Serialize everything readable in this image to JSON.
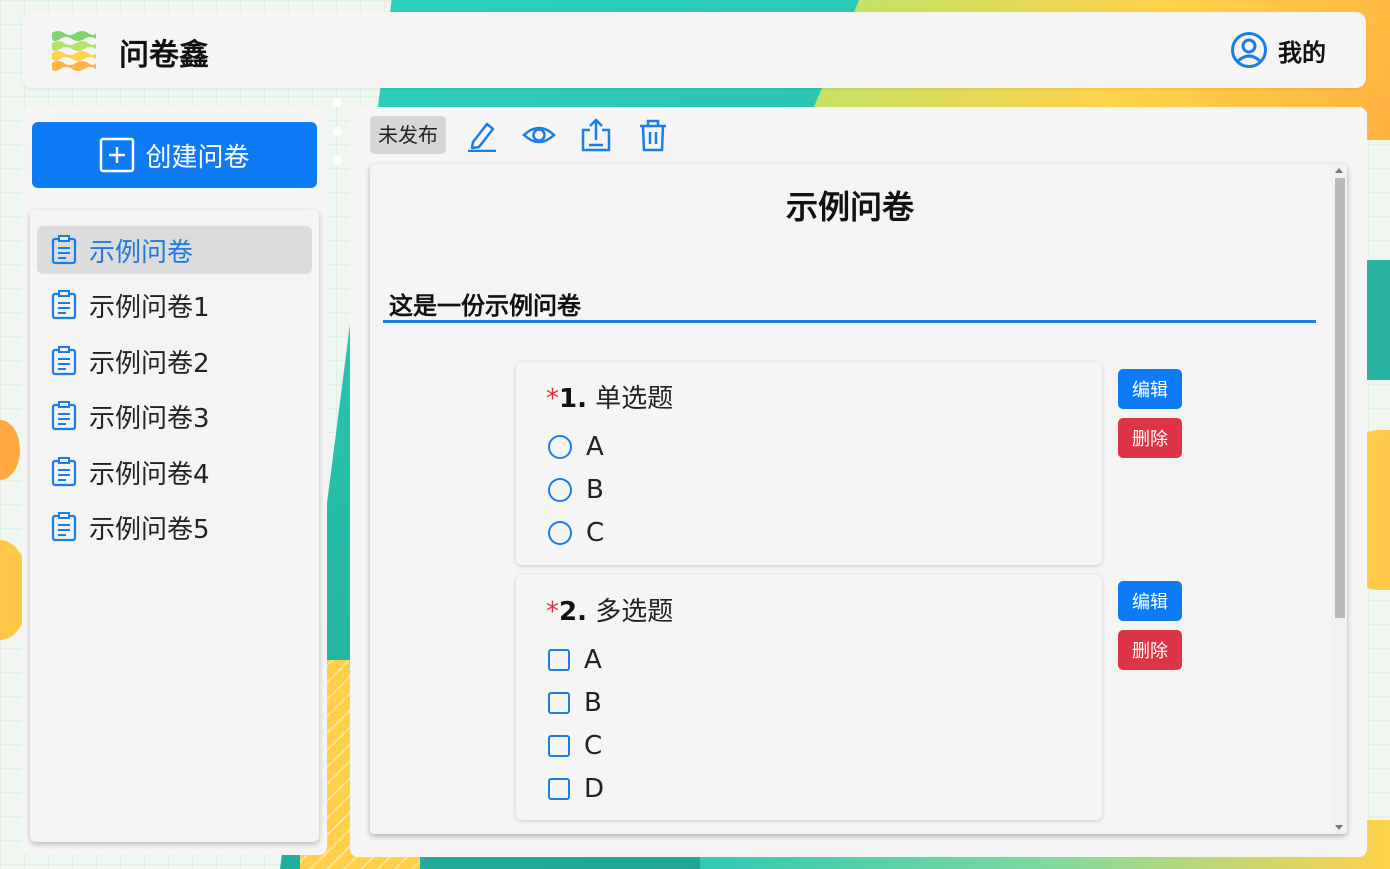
{
  "header": {
    "app_title": "问卷鑫",
    "user_label": "我的"
  },
  "sidebar": {
    "create_button": "创建问卷",
    "items": [
      {
        "label": "示例问卷",
        "active": true
      },
      {
        "label": "示例问卷1",
        "active": false
      },
      {
        "label": "示例问卷2",
        "active": false
      },
      {
        "label": "示例问卷3",
        "active": false
      },
      {
        "label": "示例问卷4",
        "active": false
      },
      {
        "label": "示例问卷5",
        "active": false
      }
    ]
  },
  "toolbar": {
    "status": "未发布",
    "tools": [
      "edit-icon",
      "preview-eye-icon",
      "export-icon",
      "delete-trash-icon"
    ]
  },
  "survey": {
    "title": "示例问卷",
    "description": "这是一份示例问卷",
    "questions": [
      {
        "required_mark": "*",
        "number": "1.",
        "title": "单选题",
        "type": "radio",
        "options": [
          "A",
          "B",
          "C"
        ],
        "edit_label": "编辑",
        "delete_label": "删除"
      },
      {
        "required_mark": "*",
        "number": "2.",
        "title": "多选题",
        "type": "checkbox",
        "options": [
          "A",
          "B",
          "C",
          "D"
        ],
        "edit_label": "编辑",
        "delete_label": "删除"
      }
    ]
  },
  "colors": {
    "primary": "#0d7cf4",
    "danger": "#dd3545",
    "required": "#e03040"
  }
}
